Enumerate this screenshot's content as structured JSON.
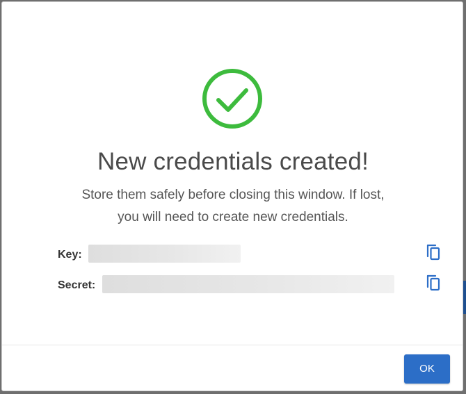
{
  "dialog": {
    "title": "New credentials created!",
    "message_line1": "Store them safely before closing this window. If lost,",
    "message_line2": "you will need to create new credentials.",
    "success_icon": "check-circle-icon",
    "colors": {
      "success": "#3dbb3d",
      "primary": "#2c6ec7",
      "copy_icon": "#2c6ec7"
    }
  },
  "fields": {
    "key": {
      "label": "Key:",
      "value_state": "redacted",
      "copy_icon": "copy-icon"
    },
    "secret": {
      "label": "Secret:",
      "value_state": "redacted",
      "copy_icon": "copy-icon"
    }
  },
  "footer": {
    "ok_label": "OK"
  }
}
